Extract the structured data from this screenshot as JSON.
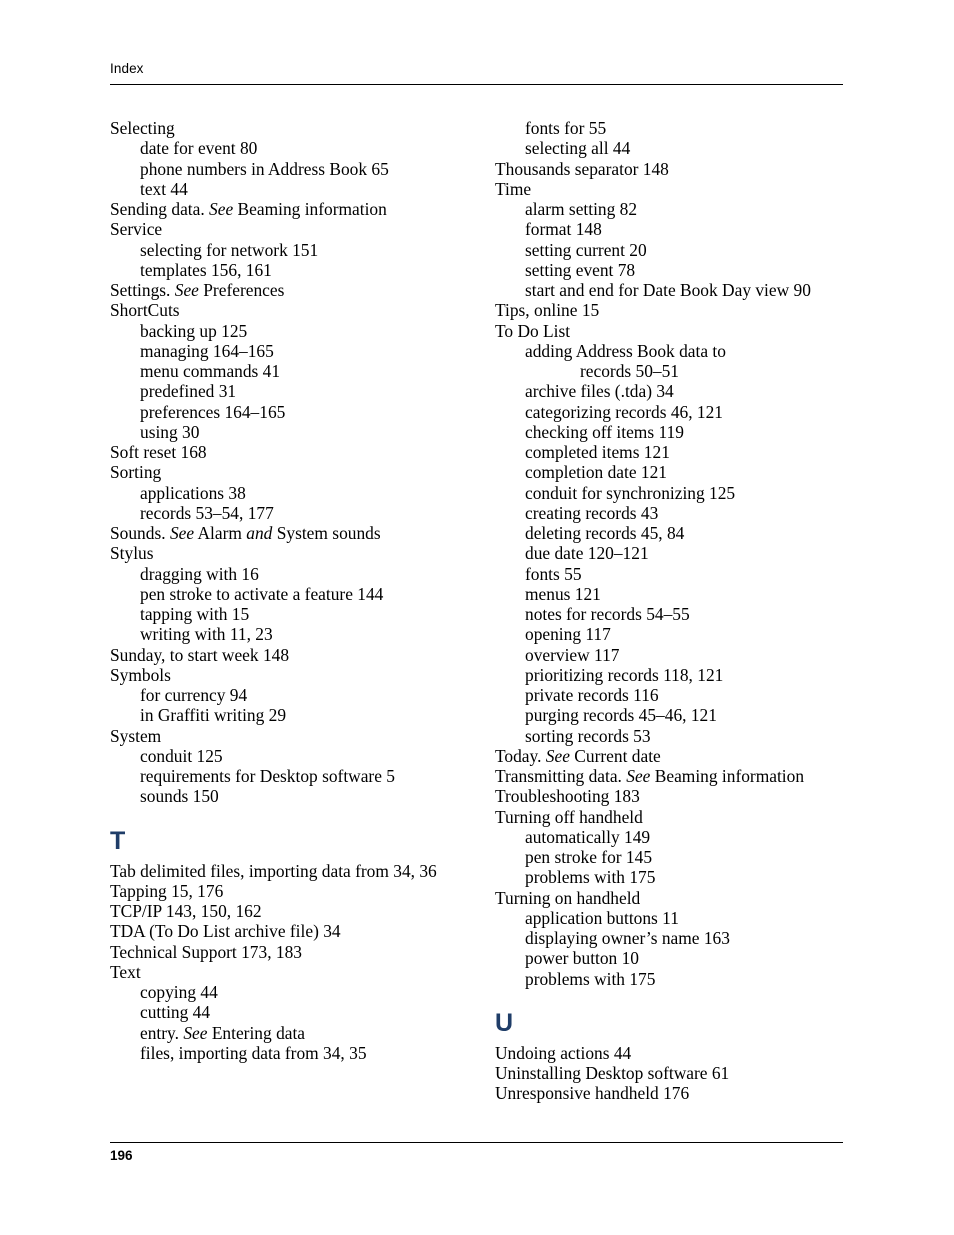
{
  "header": {
    "running_head": "Index"
  },
  "footer": {
    "page_number": "196"
  },
  "colors": {
    "section_letter": "#1F3D68",
    "text": "#000000",
    "rule": "#000000"
  },
  "left_column": {
    "entries": [
      {
        "level": 0,
        "text": "Selecting"
      },
      {
        "level": 1,
        "text": "date for event  80"
      },
      {
        "level": 1,
        "text": "phone numbers in Address Book  65"
      },
      {
        "level": 1,
        "text": "text  44"
      },
      {
        "level": 0,
        "text": "Sending data. See Beaming information",
        "italic_words": [
          "See"
        ]
      },
      {
        "level": 0,
        "text": "Service"
      },
      {
        "level": 1,
        "text": "selecting for network  151"
      },
      {
        "level": 1,
        "text": "templates  156, 161"
      },
      {
        "level": 0,
        "text": "Settings. See Preferences",
        "italic_words": [
          "See"
        ]
      },
      {
        "level": 0,
        "text": "ShortCuts"
      },
      {
        "level": 1,
        "text": "backing up  125"
      },
      {
        "level": 1,
        "text": "managing  164–165"
      },
      {
        "level": 1,
        "text": "menu commands  41"
      },
      {
        "level": 1,
        "text": "predefined  31"
      },
      {
        "level": 1,
        "text": "preferences  164–165"
      },
      {
        "level": 1,
        "text": "using  30"
      },
      {
        "level": 0,
        "text": "Soft reset  168"
      },
      {
        "level": 0,
        "text": "Sorting"
      },
      {
        "level": 1,
        "text": "applications  38"
      },
      {
        "level": 1,
        "text": "records  53–54, 177"
      },
      {
        "level": 0,
        "text": "Sounds. See Alarm and System sounds",
        "italic_words": [
          "See",
          "and"
        ]
      },
      {
        "level": 0,
        "text": "Stylus"
      },
      {
        "level": 1,
        "text": "dragging with  16"
      },
      {
        "level": 1,
        "text": "pen stroke to activate a feature  144"
      },
      {
        "level": 1,
        "text": "tapping with  15"
      },
      {
        "level": 1,
        "text": "writing with  11, 23"
      },
      {
        "level": 0,
        "text": "Sunday, to start week  148"
      },
      {
        "level": 0,
        "text": "Symbols"
      },
      {
        "level": 1,
        "text": "for currency  94"
      },
      {
        "level": 1,
        "text": "in Graffiti writing  29"
      },
      {
        "level": 0,
        "text": "System"
      },
      {
        "level": 1,
        "text": "conduit  125"
      },
      {
        "level": 1,
        "text": "requirements for Desktop software  5"
      },
      {
        "level": 1,
        "text": "sounds  150"
      }
    ],
    "section_letter": "T",
    "entries_after_letter": [
      {
        "level": 0,
        "text": "Tab delimited files, importing data from  34, 36"
      },
      {
        "level": 0,
        "text": "Tapping  15, 176"
      },
      {
        "level": 0,
        "text": "TCP/IP  143, 150, 162"
      },
      {
        "level": 0,
        "text": "TDA (To Do List archive file)  34"
      },
      {
        "level": 0,
        "text": "Technical Support  173, 183"
      },
      {
        "level": 0,
        "text": "Text"
      },
      {
        "level": 1,
        "text": "copying  44"
      },
      {
        "level": 1,
        "text": "cutting  44"
      },
      {
        "level": 1,
        "text": "entry. See Entering data",
        "italic_words": [
          "See"
        ]
      },
      {
        "level": 1,
        "text": "files, importing data from  34, 35"
      }
    ]
  },
  "right_column": {
    "entries": [
      {
        "level": 1,
        "text": "fonts for  55"
      },
      {
        "level": 1,
        "text": "selecting all  44"
      },
      {
        "level": 0,
        "text": "Thousands separator  148"
      },
      {
        "level": 0,
        "text": "Time"
      },
      {
        "level": 1,
        "text": "alarm setting  82"
      },
      {
        "level": 1,
        "text": "format  148"
      },
      {
        "level": 1,
        "text": "setting current  20"
      },
      {
        "level": 1,
        "text": "setting event  78"
      },
      {
        "level": 1,
        "text": "start and end for Date Book Day view  90"
      },
      {
        "level": 0,
        "text": "Tips, online  15"
      },
      {
        "level": 0,
        "text": "To Do List"
      },
      {
        "level": 2,
        "text": "adding Address Book data to",
        "deep_continuation": "records  50–51"
      },
      {
        "level": 1,
        "text": "archive files (.tda)  34"
      },
      {
        "level": 1,
        "text": "categorizing records  46, 121"
      },
      {
        "level": 1,
        "text": "checking off items  119"
      },
      {
        "level": 1,
        "text": "completed items  121"
      },
      {
        "level": 1,
        "text": "completion date  121"
      },
      {
        "level": 1,
        "text": "conduit for synchronizing  125"
      },
      {
        "level": 1,
        "text": "creating records  43"
      },
      {
        "level": 1,
        "text": "deleting records  45, 84"
      },
      {
        "level": 1,
        "text": "due date  120–121"
      },
      {
        "level": 1,
        "text": "fonts  55"
      },
      {
        "level": 1,
        "text": "menus  121"
      },
      {
        "level": 1,
        "text": "notes for records  54–55"
      },
      {
        "level": 1,
        "text": "opening  117"
      },
      {
        "level": 1,
        "text": "overview  117"
      },
      {
        "level": 1,
        "text": "prioritizing records  118, 121"
      },
      {
        "level": 1,
        "text": "private records  116"
      },
      {
        "level": 1,
        "text": "purging records  45–46, 121"
      },
      {
        "level": 1,
        "text": "sorting records  53"
      },
      {
        "level": 0,
        "text": "Today. See Current date",
        "italic_words": [
          "See"
        ]
      },
      {
        "level": 0,
        "text": "Transmitting data. See Beaming information",
        "italic_words": [
          "See"
        ]
      },
      {
        "level": 0,
        "text": "Troubleshooting  183"
      },
      {
        "level": 0,
        "text": "Turning off handheld"
      },
      {
        "level": 1,
        "text": "automatically  149"
      },
      {
        "level": 1,
        "text": "pen stroke for  145"
      },
      {
        "level": 1,
        "text": "problems with  175"
      },
      {
        "level": 0,
        "text": "Turning on handheld"
      },
      {
        "level": 1,
        "text": "application buttons  11"
      },
      {
        "level": 1,
        "text": "displaying owner’s name  163"
      },
      {
        "level": 1,
        "text": "power button  10"
      },
      {
        "level": 1,
        "text": "problems with  175"
      }
    ],
    "section_letter": "U",
    "entries_after_letter": [
      {
        "level": 0,
        "text": "Undoing actions  44"
      },
      {
        "level": 0,
        "text": "Uninstalling Desktop software  61"
      },
      {
        "level": 0,
        "text": "Unresponsive handheld  176"
      }
    ]
  }
}
